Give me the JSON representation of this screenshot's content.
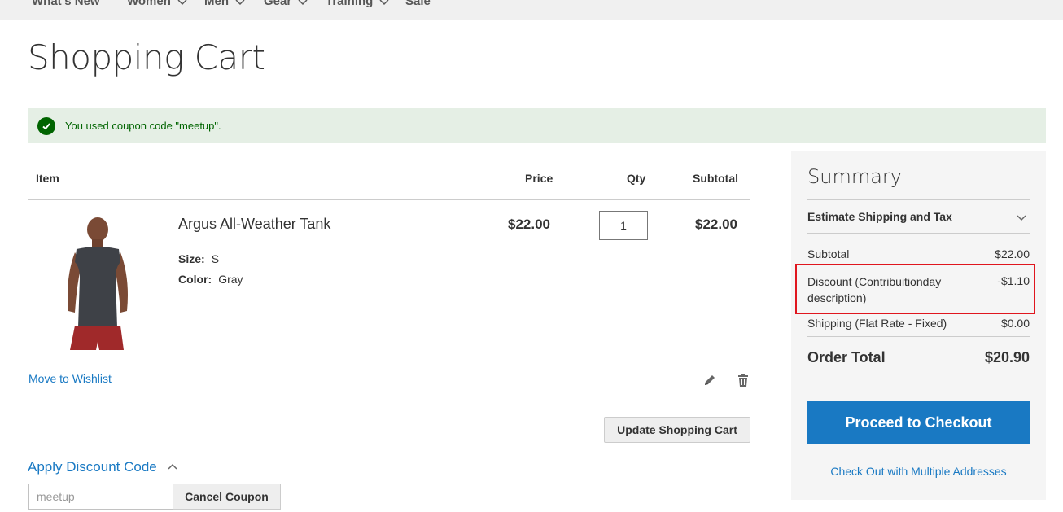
{
  "nav": {
    "items": [
      {
        "label": "What's New",
        "has_dropdown": false
      },
      {
        "label": "Women",
        "has_dropdown": true
      },
      {
        "label": "Men",
        "has_dropdown": true
      },
      {
        "label": "Gear",
        "has_dropdown": true
      },
      {
        "label": "Training",
        "has_dropdown": true
      },
      {
        "label": "Sale",
        "has_dropdown": false
      }
    ]
  },
  "page": {
    "title": "Shopping Cart",
    "success_message": "You used coupon code \"meetup\"."
  },
  "cart": {
    "headers": {
      "item": "Item",
      "price": "Price",
      "qty": "Qty",
      "subtotal": "Subtotal"
    },
    "item": {
      "name": "Argus All-Weather Tank",
      "options": [
        {
          "label": "Size:",
          "value": "S"
        },
        {
          "label": "Color:",
          "value": "Gray"
        }
      ],
      "price": "$22.00",
      "qty": "1",
      "subtotal": "$22.00",
      "move_to_wishlist": "Move to Wishlist",
      "edit_icon": "pencil-icon",
      "delete_icon": "trash-icon"
    },
    "update_button": "Update Shopping Cart"
  },
  "discount": {
    "title": "Apply Discount Code",
    "input_value": "meetup",
    "cancel_button": "Cancel Coupon"
  },
  "summary": {
    "title": "Summary",
    "estimate_label": "Estimate Shipping and Tax",
    "rows": {
      "subtotal_label": "Subtotal",
      "subtotal_value": "$22.00",
      "discount_label": "Discount (Contribuitionday description)",
      "discount_value": "-$1.10",
      "shipping_label": "Shipping (Flat Rate - Fixed)",
      "shipping_value": "$0.00"
    },
    "order_total_label": "Order Total",
    "order_total_value": "$20.90",
    "checkout_button": "Proceed to Checkout",
    "multi_address_link": "Check Out with Multiple Addresses"
  },
  "colors": {
    "link": "#1979c3",
    "success_bg": "#e5efe5",
    "success_text": "#006400",
    "highlight": "#e0161e"
  }
}
